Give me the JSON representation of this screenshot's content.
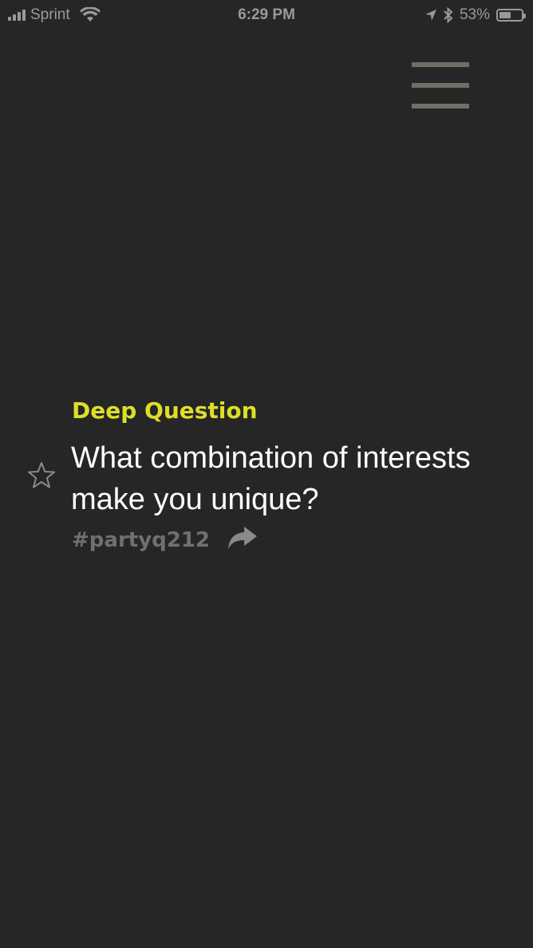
{
  "status_bar": {
    "carrier": "Sprint",
    "time": "6:29 PM",
    "battery": "53%",
    "battery_level": 0.53,
    "icons": [
      "signal-icon",
      "wifi-icon",
      "location-icon",
      "bluetooth-icon",
      "battery-icon"
    ]
  },
  "menu": {
    "icon": "hamburger-menu-icon"
  },
  "card": {
    "category": "Deep Question",
    "question": "What combination of interests make you unique?",
    "hashtag": "#partyq212",
    "favorite_icon": "star-outline-icon",
    "share_icon": "share-arrow-icon"
  },
  "colors": {
    "background": "#262626",
    "category": "#dede2a",
    "question": "#ffffff",
    "hashtag": "#707070",
    "menu_bars": "#6f6f66"
  }
}
